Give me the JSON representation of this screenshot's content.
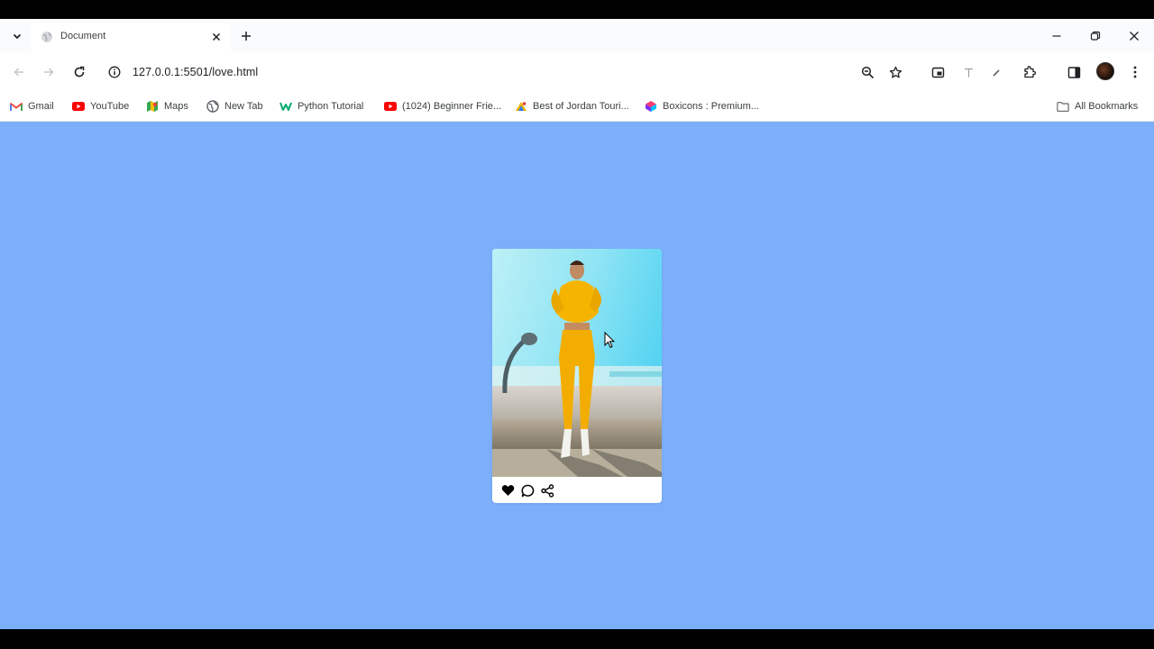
{
  "tab": {
    "title": "Document"
  },
  "address_bar": {
    "url": "127.0.0.1:5501/love.html"
  },
  "bookmarks": [
    {
      "label": "Gmail",
      "icon": "gmail-icon"
    },
    {
      "label": "YouTube",
      "icon": "youtube-icon"
    },
    {
      "label": "Maps",
      "icon": "maps-icon"
    },
    {
      "label": "New Tab",
      "icon": "globe-icon"
    },
    {
      "label": "Python Tutorial",
      "icon": "w3-icon"
    },
    {
      "label": "(1024) Beginner Frie...",
      "icon": "youtube-icon"
    },
    {
      "label": "Best of Jordan Touri...",
      "icon": "site-icon"
    },
    {
      "label": "Boxicons : Premium...",
      "icon": "boxicons-icon"
    }
  ],
  "all_bookmarks": "All Bookmarks",
  "card": {
    "photo_alt": "",
    "actions": [
      "heart-icon",
      "comment-icon",
      "share-icon"
    ]
  },
  "colors": {
    "page_background": "#7caffa",
    "card_background": "#ffffff",
    "tabstrip": "#f9fbfd"
  }
}
